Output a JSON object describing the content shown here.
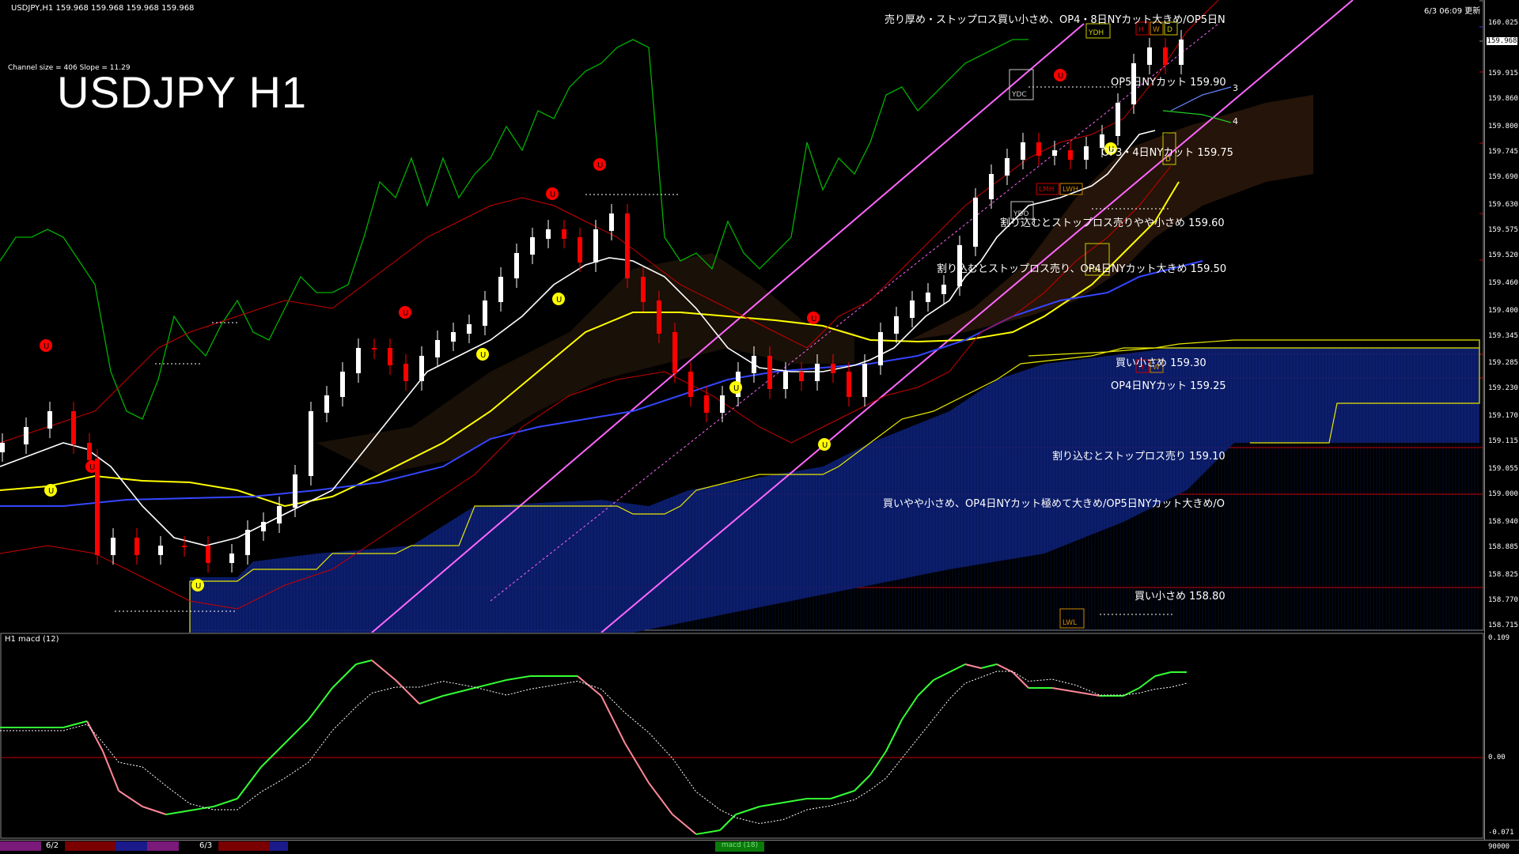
{
  "header": {
    "symbol_line": "USDJPY,H1  159.968 159.968 159.968 159.968",
    "datetime": "6/3 06:09 更新",
    "channel_info": "Channel size = 406 Slope = 11.29",
    "chart_title": "USDJPY H1",
    "macd_label": "H1  macd (12)"
  },
  "axis": {
    "price_labels": [
      "160.025",
      "159.915",
      "159.860",
      "159.800",
      "159.745",
      "159.690",
      "159.630",
      "159.575",
      "159.520",
      "159.460",
      "159.400",
      "159.345",
      "159.285",
      "159.230",
      "159.170",
      "159.115",
      "159.055",
      "159.000",
      "158.940",
      "158.885",
      "158.825",
      "158.770",
      "158.715"
    ],
    "current_price": "159.968",
    "macd_labels": [
      "0.109",
      "0.00",
      "-0.071",
      "90000"
    ]
  },
  "annotations": [
    {
      "id": "ann-1",
      "text": "売り厚め・ストップロス買い小さめ、OP4・8日NYカット大きめ/OP5日N"
    },
    {
      "id": "ann-2",
      "text": "OP5日NYカット 159.90"
    },
    {
      "id": "ann-3",
      "text": "OP3・4日NYカット 159.75"
    },
    {
      "id": "ann-4",
      "text": "割り込むとストップロス売りやや小さめ 159.60"
    },
    {
      "id": "ann-5",
      "text": "割り込むとストップロス売り、OP4日NYカット大きめ 159.50"
    },
    {
      "id": "ann-6",
      "text": "買い小さめ 159.30"
    },
    {
      "id": "ann-7",
      "text": "OP4日NYカット 159.25"
    },
    {
      "id": "ann-8",
      "text": "割り込むとストップロス売り 159.10"
    },
    {
      "id": "ann-9",
      "text": "買いやや小さめ、OP4日NYカット極めて大きめ/OP5日NYカット大きめ/O"
    },
    {
      "id": "ann-10",
      "text": "買い小さめ 158.80"
    }
  ],
  "markers": {
    "ydh": "YDH",
    "ydc": "YDC",
    "ydo": "YDO",
    "ydl": "YDL",
    "lwh": "LWH",
    "lwl": "LWL",
    "lmh": "LMH",
    "h": "H",
    "w": "W",
    "d": "D",
    "n3": "3",
    "n4": "4"
  },
  "bottom_bar": {
    "dates": [
      "6/2",
      "6/3"
    ],
    "tab_label": "macd (18)"
  },
  "colors": {
    "background": "#000000",
    "level_line": "#cc0000",
    "channel": "#ff66ff",
    "ichimoku_green": "#00aa00",
    "ma_white": "#ffffff",
    "ma_yellow": "#ffff00",
    "ma_blue": "#2a3cff",
    "bull_candle": "#ffffff",
    "bear_candle": "#ff0000",
    "macd_up": "#33ff33",
    "macd_down": "#ff8899"
  }
}
